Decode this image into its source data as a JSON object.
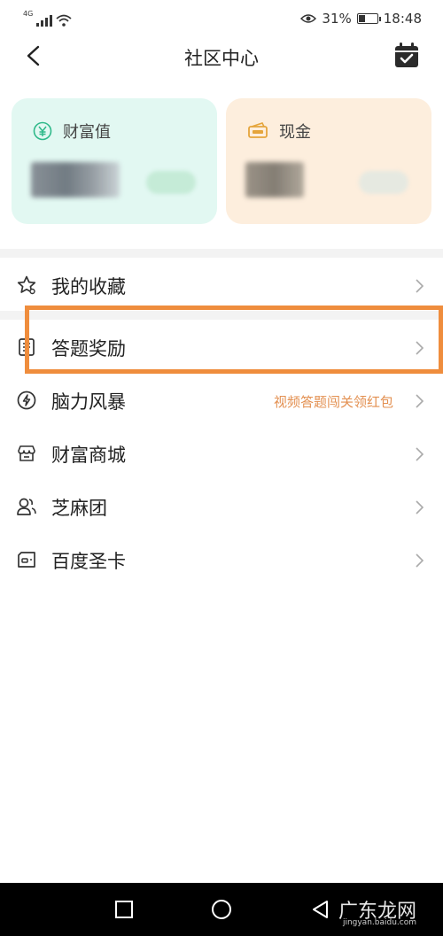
{
  "status_bar": {
    "network": "4G",
    "battery_percent": "31%",
    "battery_level": 0.31,
    "time": "18:48",
    "icons": [
      "signal-icon",
      "wifi-icon",
      "eye-icon",
      "battery-icon"
    ]
  },
  "header": {
    "title": "社区中心",
    "back_icon": "chevron-left-icon",
    "calendar_icon": "calendar-check-icon"
  },
  "cards": {
    "wealth": {
      "label": "财富值",
      "icon": "yuan-circle-icon"
    },
    "cash": {
      "label": "现金",
      "icon": "cash-icon"
    }
  },
  "menu": {
    "items": [
      {
        "label": "我的收藏",
        "icon": "star-icon",
        "hint": ""
      },
      {
        "label": "答题奖励",
        "icon": "book-icon",
        "hint": ""
      },
      {
        "label": "脑力风暴",
        "icon": "brain-bolt-icon",
        "hint": "视频答题闯关领红包"
      },
      {
        "label": "财富商城",
        "icon": "store-icon",
        "hint": ""
      },
      {
        "label": "芝麻团",
        "icon": "group-icon",
        "hint": ""
      },
      {
        "label": "百度圣卡",
        "icon": "sim-card-icon",
        "hint": ""
      }
    ]
  },
  "colors": {
    "highlight": "#ef8d3d",
    "hint": "#e39051",
    "wealth_card": "#e2f8f2",
    "cash_card": "#fdeedd",
    "wealth_icon": "#2fb98a",
    "cash_icon": "#e5a53c"
  },
  "watermark": {
    "main": "广东龙网",
    "sub": "jingyan.baidu.com"
  }
}
